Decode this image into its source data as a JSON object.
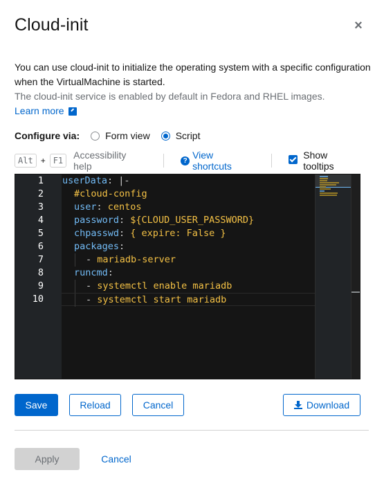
{
  "modal": {
    "title": "Cloud-init",
    "close": "×"
  },
  "description": {
    "line1": "You can use cloud-init to initialize the operating system with a specific configuration when the VirtualMachine is started.",
    "line2": "The cloud-init service is enabled by default in Fedora and RHEL images.",
    "learn_more": "Learn more"
  },
  "configure": {
    "label": "Configure via:",
    "options": [
      "Form view",
      "Script"
    ],
    "selected": "Script"
  },
  "toolbar": {
    "key1": "Alt",
    "plus": "+",
    "key2": "F1",
    "accessibility_help": "Accessibility help",
    "view_shortcuts": "View shortcuts",
    "show_tooltips": "Show tooltips",
    "show_tooltips_checked": true
  },
  "editor": {
    "line_numbers": [
      "1",
      "2",
      "3",
      "4",
      "5",
      "6",
      "7",
      "8",
      "9",
      "10"
    ],
    "lines": [
      "userData: |-",
      "#cloud-config",
      "user: centos",
      "password: ${CLOUD_USER_PASSWORD}",
      "chpasswd: { expire: False }",
      "packages:",
      "- mariadb-server",
      "runcmd:",
      "- systemctl enable mariadb",
      "- systemctl start mariadb"
    ],
    "active_line": 10
  },
  "actions": {
    "save": "Save",
    "reload": "Reload",
    "cancel": "Cancel",
    "download": "Download"
  },
  "footer": {
    "apply": "Apply",
    "cancel": "Cancel"
  },
  "colors": {
    "primary": "#0066cc",
    "editor_bg": "#151515",
    "key_blue": "#73bcf7",
    "value_yellow": "#f4c145"
  }
}
